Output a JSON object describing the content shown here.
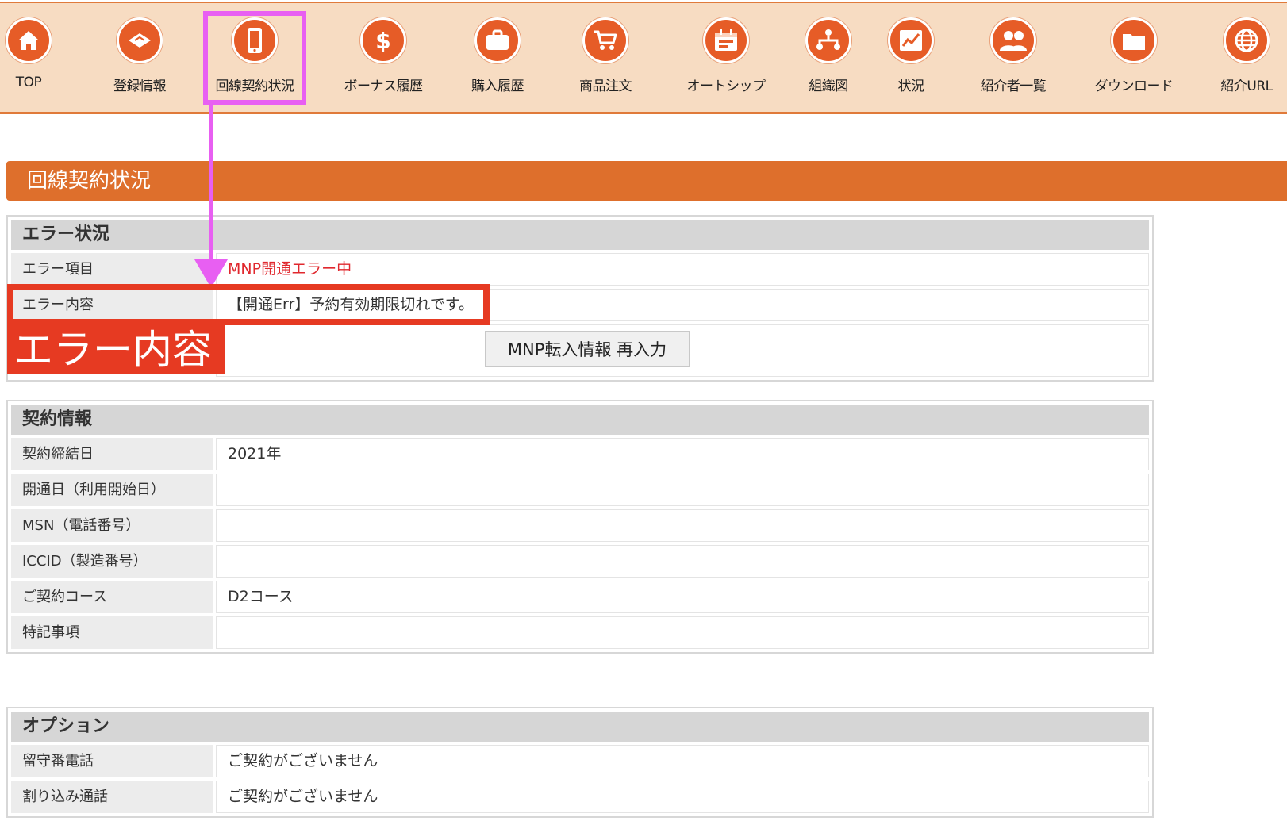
{
  "nav": {
    "items": [
      {
        "label": "TOP",
        "icon": "home-icon"
      },
      {
        "label": "登録情報",
        "icon": "card-icon"
      },
      {
        "label": "回線契約状況",
        "icon": "phone-icon"
      },
      {
        "label": "ボーナス履歴",
        "icon": "dollar-icon"
      },
      {
        "label": "購入履歴",
        "icon": "briefcase-icon"
      },
      {
        "label": "商品注文",
        "icon": "cart-icon"
      },
      {
        "label": "オートシップ",
        "icon": "calendar-icon"
      },
      {
        "label": "組織図",
        "icon": "tree-icon"
      },
      {
        "label": "状況",
        "icon": "chart-icon"
      },
      {
        "label": "紹介者一覧",
        "icon": "users-icon"
      },
      {
        "label": "ダウンロード",
        "icon": "folder-icon"
      },
      {
        "label": "紹介URL",
        "icon": "globe-icon"
      }
    ],
    "active_index": 2,
    "accent_color": "#e65c27",
    "background_color": "#f7dcc2"
  },
  "page": {
    "title": "回線契約状況"
  },
  "error_panel": {
    "title": "エラー状況",
    "rows": [
      {
        "label": "エラー項目",
        "value": "MNP開通エラー中"
      },
      {
        "label": "エラー内容",
        "value": "【開通Err】予約有効期限切れです。"
      }
    ],
    "button_label": "MNP転入情報 再入力"
  },
  "contract_panel": {
    "title": "契約情報",
    "rows": [
      {
        "label": "契約締結日",
        "value": "2021年"
      },
      {
        "label": "開通日（利用開始日）",
        "value": ""
      },
      {
        "label": "MSN（電話番号）",
        "value": ""
      },
      {
        "label": "ICCID（製造番号）",
        "value": ""
      },
      {
        "label": "ご契約コース",
        "value": "D2コース"
      },
      {
        "label": "特記事項",
        "value": ""
      }
    ]
  },
  "option_panel": {
    "title": "オプション",
    "rows": [
      {
        "label": "留守番電話",
        "value": "ご契約がございません"
      },
      {
        "label": "割り込み通話",
        "value": "ご契約がございません"
      }
    ]
  },
  "annotation": {
    "label": "エラー内容",
    "highlight_color": "#e85ff2",
    "marker_color": "#e63a22"
  }
}
